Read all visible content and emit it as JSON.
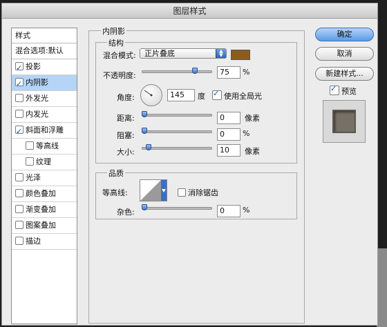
{
  "dialog": {
    "title": "图层样式"
  },
  "stylelist": {
    "header": "样式",
    "items": [
      {
        "label": "混合选项:默认",
        "checkbox": false,
        "checked": false
      },
      {
        "label": "投影",
        "checkbox": true,
        "checked": true
      },
      {
        "label": "内阴影",
        "checkbox": true,
        "checked": true,
        "selected": true
      },
      {
        "label": "外发光",
        "checkbox": true,
        "checked": false
      },
      {
        "label": "内发光",
        "checkbox": true,
        "checked": false
      },
      {
        "label": "斜面和浮雕",
        "checkbox": true,
        "checked": true
      },
      {
        "label": "等高线",
        "checkbox": true,
        "checked": false
      },
      {
        "label": "纹理",
        "checkbox": true,
        "checked": false
      },
      {
        "label": "光泽",
        "checkbox": true,
        "checked": false
      },
      {
        "label": "颜色叠加",
        "checkbox": true,
        "checked": false
      },
      {
        "label": "渐变叠加",
        "checkbox": true,
        "checked": false
      },
      {
        "label": "图案叠加",
        "checkbox": true,
        "checked": false
      },
      {
        "label": "描边",
        "checkbox": true,
        "checked": false
      }
    ]
  },
  "inner_shadow": {
    "section_title": "内阴影",
    "structure_title": "结构",
    "blend_mode_label": "混合模式:",
    "blend_mode_value": "正片叠底",
    "shadow_color": "#8c5c1e",
    "opacity_label": "不透明度:",
    "opacity_value": "75",
    "opacity_unit": "%",
    "angle_label": "角度:",
    "angle_value": "145",
    "angle_unit": "度",
    "global_light_label": "使用全局光",
    "global_light_checked": true,
    "distance_label": "距离:",
    "distance_value": "0",
    "distance_unit": "像素",
    "choke_label": "阻塞:",
    "choke_value": "0",
    "choke_unit": "%",
    "size_label": "大小:",
    "size_value": "10",
    "size_unit": "像素"
  },
  "quality": {
    "title": "品质",
    "contour_label": "等高线:",
    "antialias_label": "消除锯齿",
    "antialias_checked": false,
    "noise_label": "杂色:",
    "noise_value": "0",
    "noise_unit": "%"
  },
  "buttons": {
    "ok": "确定",
    "cancel": "取消",
    "new_style": "新建样式...",
    "preview_label": "预览",
    "preview_checked": true
  }
}
